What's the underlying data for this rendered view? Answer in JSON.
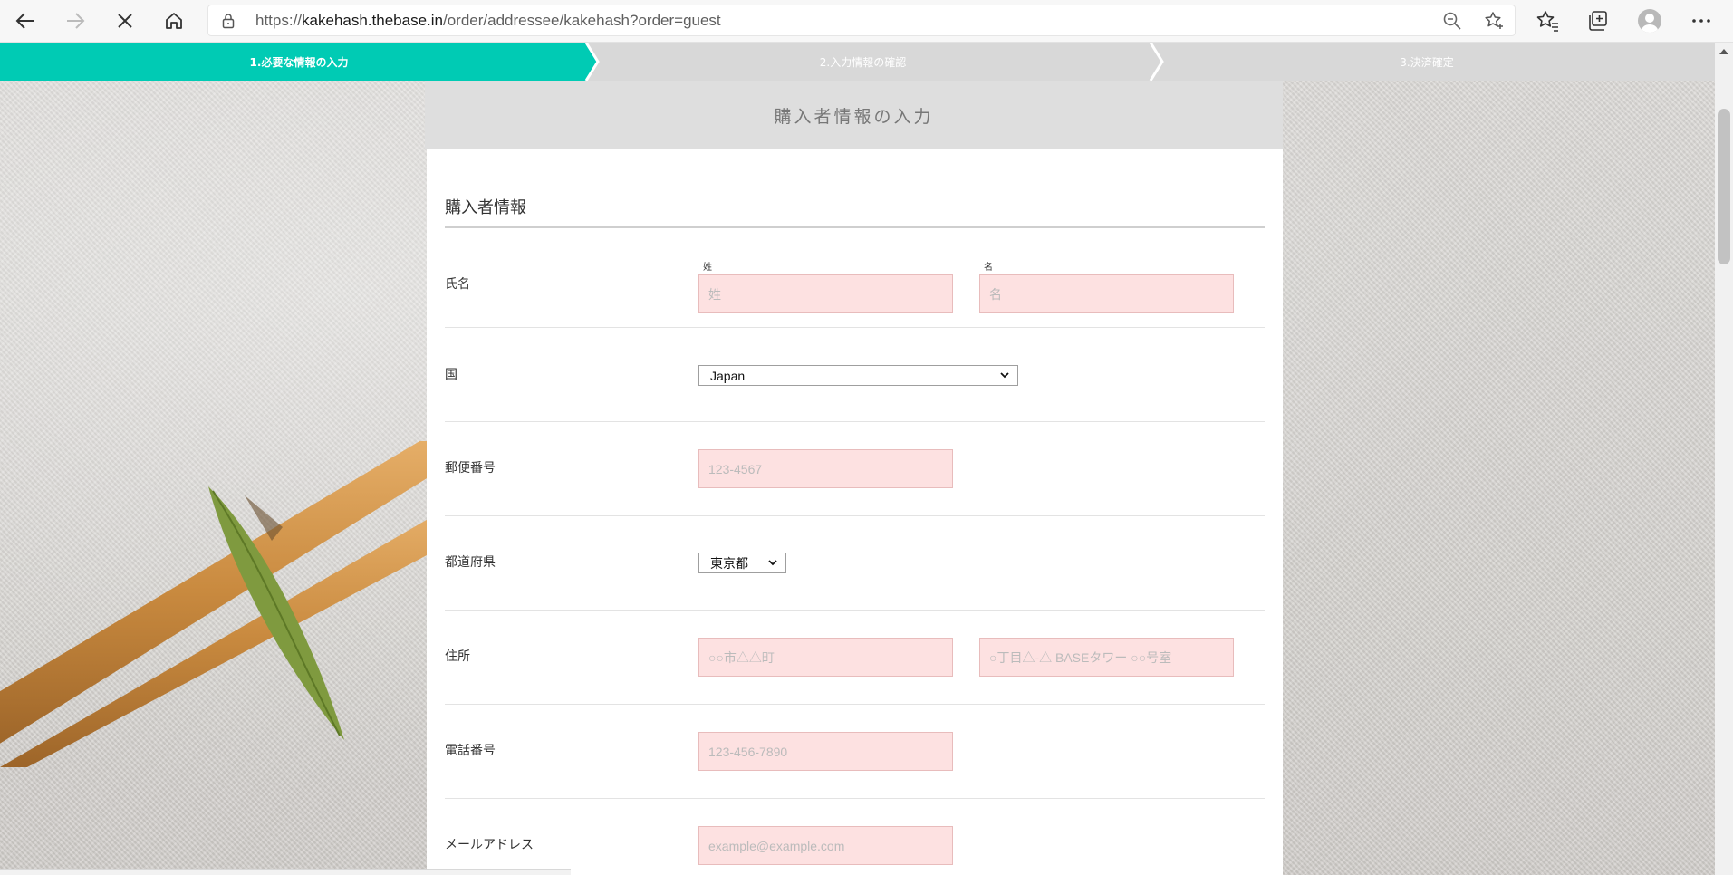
{
  "browser": {
    "url_prefix": "https://",
    "url_host": "kakehash.thebase.in",
    "url_path": "/order/addressee/kakehash?order=guest"
  },
  "steps": [
    {
      "label": "1.必要な情報の入力",
      "active": true
    },
    {
      "label": "2.入力情報の確認",
      "active": false
    },
    {
      "label": "3.決済確定",
      "active": false
    }
  ],
  "colors": {
    "accent": "#00cbb4",
    "step_inactive": "#d8d8d8",
    "field_bg": "#fde1e1",
    "field_border": "#e8bcbc"
  },
  "form": {
    "header": "購入者情報の入力",
    "section_title": "購入者情報",
    "name": {
      "label": "氏名",
      "last_label": "姓",
      "first_label": "名",
      "last_placeholder": "姓",
      "first_placeholder": "名"
    },
    "country": {
      "label": "国",
      "value": "Japan"
    },
    "postal": {
      "label": "郵便番号",
      "placeholder": "123-4567"
    },
    "prefecture": {
      "label": "都道府県",
      "value": "東京都"
    },
    "address": {
      "label": "住所",
      "placeholder1": "○○市△△町",
      "placeholder2": "○丁目△-△ BASEタワー ○○号室"
    },
    "phone": {
      "label": "電話番号",
      "placeholder": "123-456-7890"
    },
    "email": {
      "label": "メールアドレス",
      "placeholder": "example@example.com"
    }
  }
}
